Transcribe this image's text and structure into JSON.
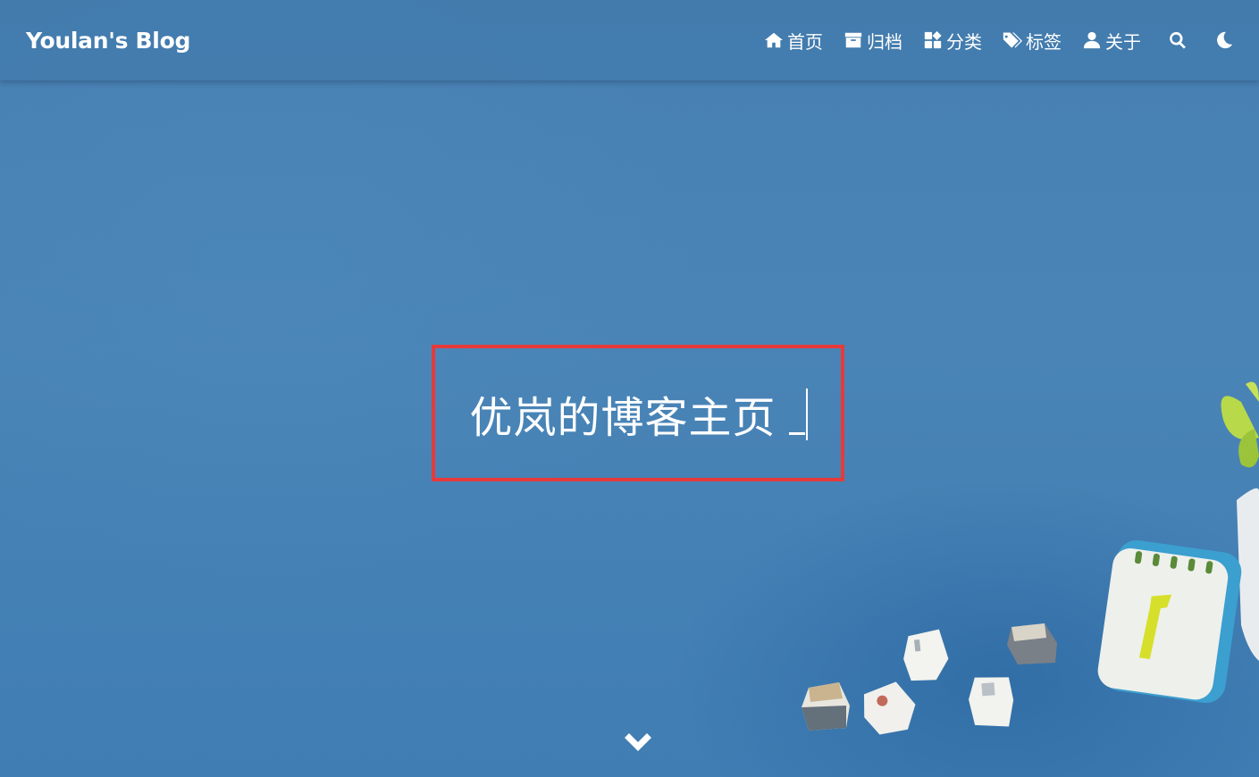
{
  "brand": {
    "title": "Youlan's Blog"
  },
  "nav": {
    "items": [
      {
        "label": "首页",
        "icon": "home-icon"
      },
      {
        "label": "归档",
        "icon": "archive-icon"
      },
      {
        "label": "分类",
        "icon": "categories-icon"
      },
      {
        "label": "标签",
        "icon": "tags-icon"
      },
      {
        "label": "关于",
        "icon": "user-icon"
      }
    ],
    "search_icon": "search-icon",
    "theme_icon": "moon-icon"
  },
  "hero": {
    "title": "优岚的博客主页",
    "highlight_color": "#e63a3a"
  },
  "scroll": {
    "icon": "chevron-down-icon"
  }
}
